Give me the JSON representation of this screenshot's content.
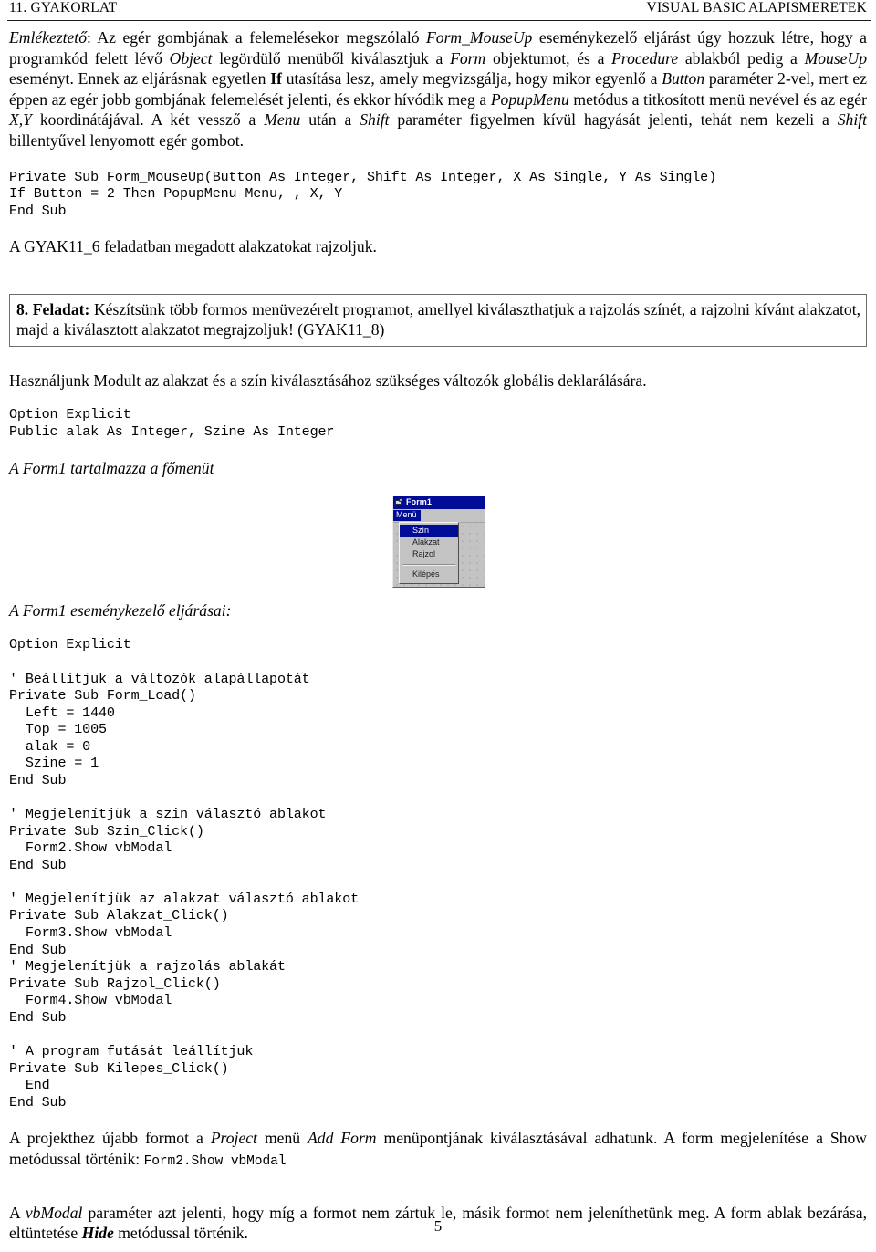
{
  "header": {
    "left": "11. GYAKORLAT",
    "right": "VISUAL BASIC ALAPISMERETEK"
  },
  "paragraphs": {
    "reminder_label": "Emlékeztető",
    "reminder_p1_a": ": Az egér gombjának a felemelésekor megszólaló ",
    "reminder_p1_code1": "Form_MouseUp",
    "reminder_p1_b": " eseménykezelő eljárást úgy hozzuk létre, hogy a programkód felett lévő ",
    "reminder_p1_code2": "Object",
    "reminder_p1_c": " legördülő menüből kiválasztjuk a ",
    "reminder_p1_code3": "Form",
    "reminder_p1_d": " objektumot, és a ",
    "reminder_p1_code4": "Procedure",
    "reminder_p1_e": " ablakból pedig a ",
    "reminder_p1_code5": "MouseUp",
    "reminder_p1_f": " eseményt. Ennek az eljárásnak egyetlen ",
    "reminder_p1_kw1": "If",
    "reminder_p1_g": " utasítása lesz, amely megvizsgálja, hogy mikor egyenlő a ",
    "reminder_p1_code6": "Button",
    "reminder_p1_h": " paraméter 2-vel, mert ez éppen az egér jobb gombjának felemelését jelenti, és ekkor hívódik meg a ",
    "reminder_p1_code7": "PopupMenu",
    "reminder_p1_i": " metódus a titkosított menü nevével és az egér ",
    "reminder_p1_code8": "X,Y",
    "reminder_p1_j": " koordinátájával. A két vessző a ",
    "reminder_p1_code9": "Menu",
    "reminder_p1_k": " után a ",
    "reminder_p1_code10": "Shift",
    "reminder_p1_l": " paraméter figyelmen kívül hagyását jelenti, tehát nem kezeli a ",
    "reminder_p1_code11": "Shift",
    "reminder_p1_m": " billentyűvel lenyomott egér gombot.",
    "after_code_1": "A GYAK11_6 feladatban megadott alakzatokat rajzoljuk.",
    "module_note": "Használjunk Modult az alakzat és a szín kiválasztásához szükséges változók globális deklarálására.",
    "form1_main_menu": "A Form1 tartalmazza a főmenüt",
    "form1_handlers": "A Form1 eseménykezelő eljárásai:",
    "addform_a": "A projekthez újabb formot a ",
    "addform_code1": "Project",
    "addform_b": " menü ",
    "addform_code2": "Add Form",
    "addform_c": " menüpontjának kiválasztásával adhatunk. A form megjelenítése a Show metódussal történik: ",
    "addform_mono": "Form2.Show vbModal",
    "vbmodal_a": "A ",
    "vbmodal_code1": "vbModal",
    "vbmodal_b": " paraméter azt jelenti, hogy míg a formot nem zártuk le, másik formot nem jeleníthetünk meg. A form ablak bezárása, eltüntetése ",
    "vbmodal_code2": "Hide",
    "vbmodal_c": " metódussal történik."
  },
  "task_box": {
    "label": "8. Feladat:",
    "text": " Készítsünk több formos menüvezérelt programot, amellyel kiválaszthatjuk a rajzolás színét, a rajzolni kívánt alakzatot, majd a kiválasztott alakzatot megrajzoljuk! (GYAK11_8)"
  },
  "code_blocks": {
    "mouseup": "Private Sub Form_MouseUp(Button As Integer, Shift As Integer, X As Single, Y As Single)\nIf Button = 2 Then PopupMenu Menu, , X, Y\nEnd Sub",
    "module": "Option Explicit\nPublic alak As Integer, Szine As Integer",
    "form1": "Option Explicit\n\n' Beállítjuk a változók alapállapotát\nPrivate Sub Form_Load()\n  Left = 1440\n  Top = 1005\n  alak = 0\n  Szine = 1\nEnd Sub\n\n' Megjelenítjük a szin választó ablakot\nPrivate Sub Szin_Click()\n  Form2.Show vbModal\nEnd Sub\n\n' Megjelenítjük az alakzat választó ablakot\nPrivate Sub Alakzat_Click()\n  Form3.Show vbModal\nEnd Sub\n' Megjelenítjük a rajzolás ablakát\nPrivate Sub Rajzol_Click()\n  Form4.Show vbModal\nEnd Sub\n\n' A program futását leállítjuk\nPrivate Sub Kilepes_Click()\n  End\nEnd Sub"
  },
  "vb_form": {
    "title": "Form1",
    "menubar_item": "Menü",
    "menu_items": [
      {
        "label": "Szín",
        "selected": true
      },
      {
        "label": "Alakzat",
        "selected": false
      },
      {
        "label": "Rajzol",
        "selected": false
      },
      {
        "label": "Kilépés",
        "selected": false
      }
    ],
    "colors": {
      "titlebar": "#000b96",
      "face": "#c3c3c3",
      "highlight": "#000b96"
    }
  },
  "page_number": "5"
}
